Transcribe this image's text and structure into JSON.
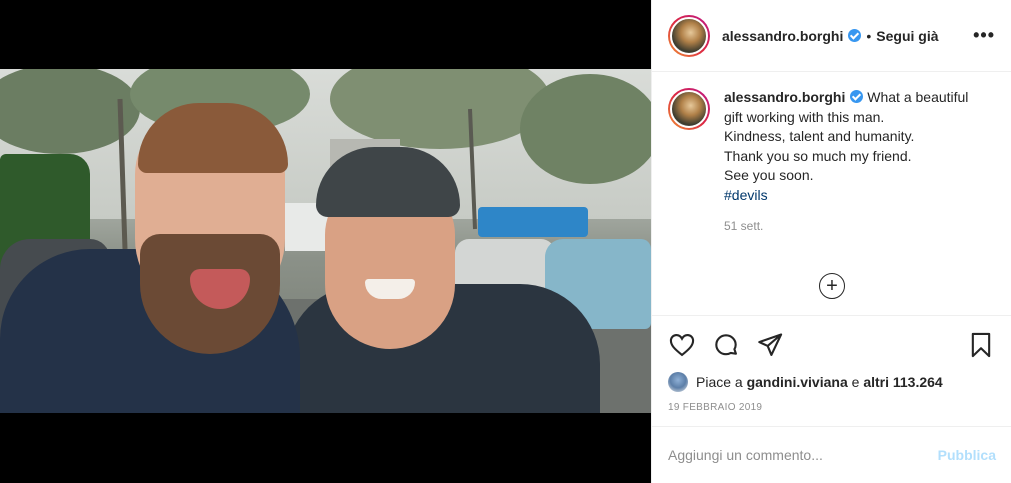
{
  "post": {
    "author": "alessandro.borghi",
    "follow_label": "Segui già",
    "more_label": "•••",
    "caption_lines": [
      "What a beautiful",
      "gift working with this man.",
      "Kindness, talent and humanity.",
      "Thank you so much my friend.",
      "See you soon."
    ],
    "hashtag": "#devils",
    "time_ago": "51 sett.",
    "load_more_label": "+",
    "likes_prefix": "Piace a ",
    "likes_user": "gandini.viviana",
    "likes_middle": " e ",
    "likes_count": "altri 113.264",
    "date": "19 FEBBRAIO 2019"
  },
  "comment": {
    "placeholder": "Aggiungi un commento...",
    "publish_label": "Pubblica"
  },
  "icons": [
    "user-tag-icon",
    "verified-icon",
    "more-icon",
    "heart-icon",
    "comment-icon",
    "share-icon",
    "bookmark-icon",
    "plus-circle-icon"
  ],
  "colors": {
    "verified": "#3897f0",
    "hashtag": "#00376b",
    "publish_disabled": "#b2dffc",
    "muted": "#8e8e8e"
  }
}
